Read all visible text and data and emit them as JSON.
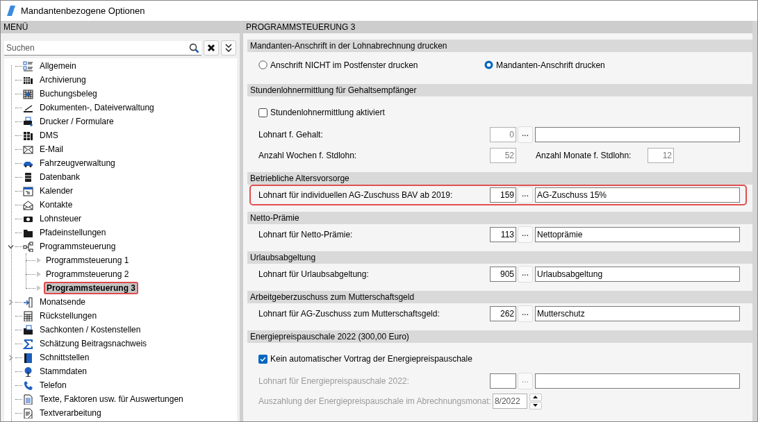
{
  "window": {
    "title": "Mandantenbezogene Optionen"
  },
  "menu": {
    "header": "MENÜ",
    "search": {
      "placeholder": "Suchen"
    },
    "items": [
      {
        "label": "Allgemein",
        "selected": false
      },
      {
        "label": "Archivierung",
        "selected": false
      },
      {
        "label": "Buchungsbeleg",
        "selected": false
      },
      {
        "label": "Dokumenten-, Dateiverwaltung",
        "selected": false
      },
      {
        "label": "Drucker / Formulare",
        "selected": false
      },
      {
        "label": "DMS",
        "selected": false
      },
      {
        "label": "E-Mail",
        "selected": false
      },
      {
        "label": "Fahrzeugverwaltung",
        "selected": false
      },
      {
        "label": "Datenbank",
        "selected": false
      },
      {
        "label": "Kalender",
        "selected": false
      },
      {
        "label": "Kontakte",
        "selected": false
      },
      {
        "label": "Lohnsteuer",
        "selected": false
      },
      {
        "label": "Pfadeinstellungen",
        "selected": false
      },
      {
        "label": "Programmsteuerung",
        "expanded": true,
        "selected": false,
        "children": [
          {
            "label": "Programmsteuerung 1",
            "selected": false
          },
          {
            "label": "Programmsteuerung 2",
            "selected": false
          },
          {
            "label": "Programmsteuerung 3",
            "selected": true
          }
        ]
      },
      {
        "label": "Monatsende",
        "expanded": false,
        "selected": false
      },
      {
        "label": "Rückstellungen",
        "selected": false
      },
      {
        "label": "Sachkonten / Kostenstellen",
        "selected": false
      },
      {
        "label": "Schätzung Beitragsnachweis",
        "selected": false
      },
      {
        "label": "Schnittstellen",
        "expanded": false,
        "selected": false
      },
      {
        "label": "Stammdaten",
        "selected": false
      },
      {
        "label": "Telefon",
        "selected": false
      },
      {
        "label": "Texte, Faktoren usw. für Auswertungen",
        "selected": false
      },
      {
        "label": "Textverarbeitung",
        "selected": false
      }
    ]
  },
  "content": {
    "header": "PROGRAMMSTEUERUNG 3",
    "sections": [
      {
        "title": "Mandanten-Anschrift in der Lohnabrechnung drucken",
        "rows": [
          {
            "kind": "radios",
            "options": [
              {
                "label": "Anschrift NICHT im Postfenster drucken",
                "selected": false
              },
              {
                "label": "Mandanten-Anschrift drucken",
                "selected": true
              }
            ]
          }
        ]
      },
      {
        "title": "Stundenlohnermittlung für Gehaltsempfänger",
        "rows": [
          {
            "kind": "checkbox",
            "label": "Stundenlohnermittlung aktiviert",
            "checked": false
          },
          {
            "kind": "lookup",
            "label": "Lohnart f. Gehalt:",
            "code": "0",
            "button": "...",
            "disabled": false,
            "inactive": true,
            "highlighted": false
          },
          {
            "kind": "pair",
            "inactive": true,
            "fields": [
              {
                "label": "Anzahl Wochen f. Stdlohn:",
                "value": "52"
              },
              {
                "label": "Anzahl Monate f. Stdlohn:",
                "value": "12"
              }
            ]
          }
        ]
      },
      {
        "title": "Betriebliche Altersvorsorge",
        "rows": [
          {
            "kind": "lookup",
            "label": "Lohnart für individuellen AG-Zuschuss BAV ab 2019:",
            "code": "159",
            "button": "...",
            "description": "AG-Zuschuss 15%",
            "disabled": false,
            "inactive": false,
            "highlighted": true
          }
        ]
      },
      {
        "title": "Netto-Prämie",
        "rows": [
          {
            "kind": "lookup",
            "label": "Lohnart für Netto-Prämie:",
            "code": "113",
            "button": "...",
            "description": "Nettoprämie",
            "disabled": false,
            "inactive": false,
            "highlighted": false
          }
        ]
      },
      {
        "title": "Urlaubsabgeltung",
        "rows": [
          {
            "kind": "lookup",
            "label": "Lohnart für Urlaubsabgeltung:",
            "code": "905",
            "button": "...",
            "description": "Urlaubsabgeltung",
            "disabled": false,
            "inactive": false,
            "highlighted": false
          }
        ]
      },
      {
        "title": "Arbeitgeberzuschuss zum Mutterschaftsgeld",
        "rows": [
          {
            "kind": "lookup",
            "label": "Lohnart für AG-Zuschuss zum Mutterschaftsgeld:",
            "code": "262",
            "button": "...",
            "description": "Mutterschutz",
            "disabled": false,
            "inactive": false,
            "highlighted": false
          }
        ]
      },
      {
        "title": "Energiepreispauschale 2022 (300,00 Euro)",
        "rows": [
          {
            "kind": "checkbox",
            "label": "Kein automatischer Vortrag der Energiepreispauschale",
            "checked": true
          },
          {
            "kind": "lookup",
            "label": "Lohnart für Energiepreispauschale 2022:",
            "button": "...",
            "disabled": true,
            "inactive": false,
            "highlighted": false
          },
          {
            "kind": "month",
            "label": "Auszahlung der Energiepreispauschale im Abrechnungsmonat:",
            "value": "8/2022",
            "disabled": true
          }
        ]
      }
    ]
  }
}
